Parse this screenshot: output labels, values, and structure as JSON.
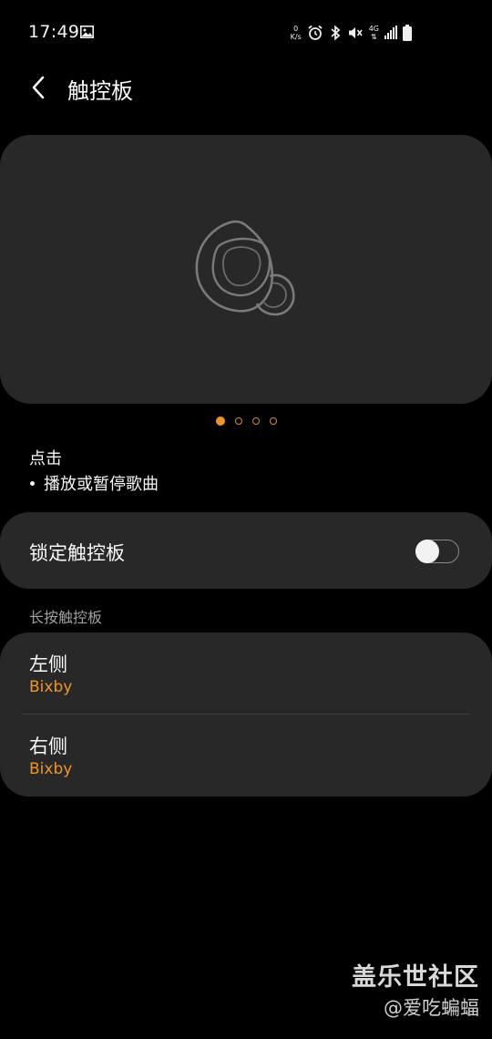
{
  "status_bar": {
    "time": "17:49",
    "netspeed_value": "0",
    "netspeed_unit": "K/s",
    "network_type": "4G",
    "icons": [
      "image-icon",
      "alarm-icon",
      "bluetooth-icon",
      "mute-icon",
      "signal-icon",
      "battery-icon"
    ]
  },
  "header": {
    "title": "触控板",
    "back_icon": "chevron-left-icon"
  },
  "illustration": {
    "icon": "earbud-icon",
    "pages": 4,
    "active_page": 1
  },
  "gesture": {
    "title": "点击",
    "description": "播放或暂停歌曲"
  },
  "lock_touchpad": {
    "label": "锁定触控板",
    "enabled": false
  },
  "long_press": {
    "section_title": "长按触控板",
    "items": [
      {
        "title": "左侧",
        "value": "Bixby"
      },
      {
        "title": "右侧",
        "value": "Bixby"
      }
    ]
  },
  "watermark": {
    "main": "盖乐世社区",
    "sub": "@爱吃蝙蝠"
  },
  "colors": {
    "accent": "#f0942a",
    "card": "#282828",
    "background": "#000000"
  }
}
